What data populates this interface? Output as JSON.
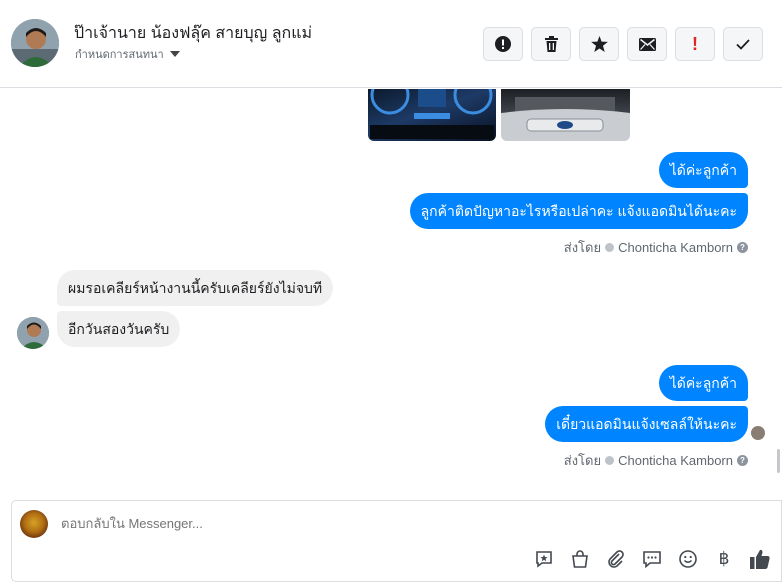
{
  "header": {
    "name": "ป๊าเจ้านาย น้องฟลุ๊ค สายบุญ ลูกแม่",
    "subtitle": "กำหนดการสนทนา"
  },
  "actions": [
    {
      "icon": "alert-icon"
    },
    {
      "icon": "trash-icon"
    },
    {
      "icon": "star-icon"
    },
    {
      "icon": "mail-icon"
    },
    {
      "icon": "exclamation-icon",
      "label": "!"
    },
    {
      "icon": "check-icon"
    }
  ],
  "messages": [
    {
      "side": "out",
      "text": "ได้ค่ะลูกค้า"
    },
    {
      "side": "out",
      "text": "ลูกค้าติดปัญหาอะไรหรือเปล่าคะ แจ้งแอดมินได้นะคะ"
    },
    {
      "side": "in",
      "text": "ผมรอเคลียร์หน้างานนี้ครับเคลียร์ยังไม่จบที"
    },
    {
      "side": "in",
      "text": "อีกวันสองวันครับ"
    },
    {
      "side": "out",
      "text": "ได้ค่ะลูกค้า"
    },
    {
      "side": "out",
      "text": "เดี๋ยวแอดมินแจ้งเซลล์ให้นะคะ"
    }
  ],
  "sent_by": [
    {
      "prefix": "ส่งโดย",
      "agent": "Chonticha Kamborn"
    },
    {
      "prefix": "ส่งโดย",
      "agent": "Chonticha Kamborn"
    }
  ],
  "composer": {
    "placeholder": "ตอบกลับใน Messenger...",
    "tools": [
      "saved-reply-icon",
      "shop-bag-icon",
      "attachment-icon",
      "chat-icon",
      "emoji-icon",
      "baht-icon",
      "like-icon"
    ],
    "baht_symbol": "฿"
  },
  "colors": {
    "outgoing_bubble": "#0084ff",
    "incoming_bubble": "#f1f0f0",
    "alert_red": "#e02424"
  }
}
